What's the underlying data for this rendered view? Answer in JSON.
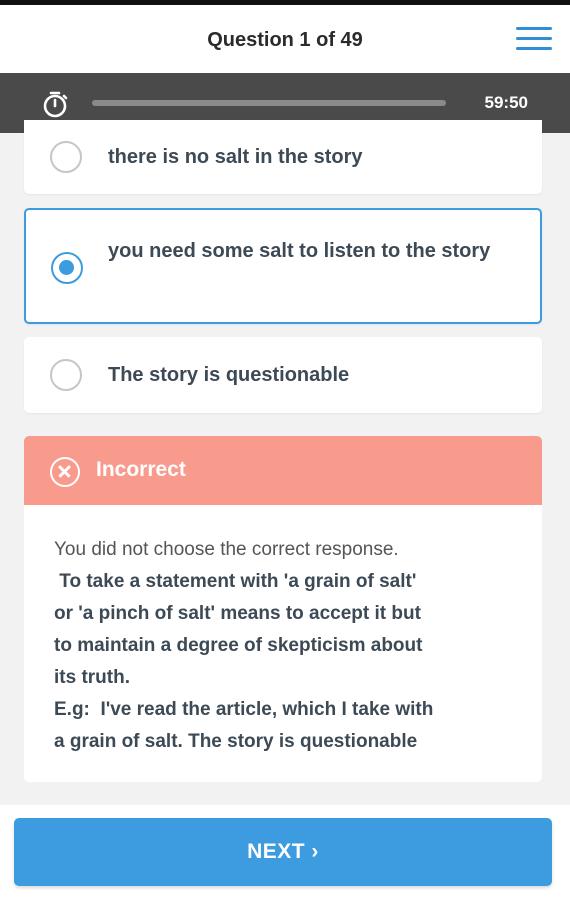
{
  "header": {
    "title": "Question 1 of 49",
    "menu_icon": "hamburger-menu-icon"
  },
  "timer": {
    "icon": "stopwatch-icon",
    "time": "59:50",
    "progress": 0.0
  },
  "options": [
    {
      "label": "there is no salt in the story",
      "selected": false
    },
    {
      "label": "you need some salt to listen to the story",
      "selected": true
    },
    {
      "label": "The story is questionable",
      "selected": false
    }
  ],
  "feedback": {
    "status": "Incorrect",
    "icon": "close-circle-icon",
    "intro": "You did not choose the correct response.",
    "lines": [
      " To take a statement with 'a grain of salt'",
      "or 'a pinch of salt' means to accept it but",
      "to maintain a degree of skepticism about",
      "its truth.",
      "E.g:  I've read the article, which I take with",
      "a grain of salt. The story is questionable"
    ]
  },
  "next_button": {
    "label": "NEXT ›"
  },
  "colors": {
    "accent": "#3d9be0",
    "incorrect": "#f89a8c",
    "timer_bar": "#4a4a4a"
  }
}
